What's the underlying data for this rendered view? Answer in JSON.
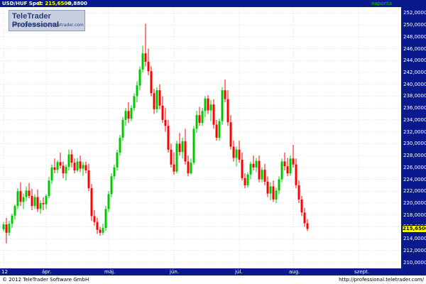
{
  "header": {
    "symbol": "USD/HUF Spot",
    "close": "C: 215,6500",
    "change": "-0,8800",
    "period": "naponta"
  },
  "logo": {
    "brand": "TeleTrader Professional",
    "url": "http://professional.teletrader.com"
  },
  "footer": {
    "copyright": "© 2012 TeleTrader Software GmbH",
    "url": "http://professional.teletrader.com/"
  },
  "colors": {
    "up": "#00c800",
    "down": "#ff0000",
    "axis_bg": "#0a1a8c",
    "grid": "#c0c0c0",
    "last_box": "#ffff00"
  },
  "chart_data": {
    "type": "candlestick",
    "last_value_label": "215,6500",
    "ylim": [
      209,
      253
    ],
    "y_tick_labels": [
      "210,0000",
      "212,0000",
      "214,0000",
      "216,0000",
      "218,0000",
      "220,0000",
      "222,0000",
      "224,0000",
      "226,0000",
      "228,0000",
      "230,0000",
      "232,0000",
      "234,0000",
      "236,0000",
      "238,0000",
      "240,0000",
      "242,0000",
      "244,0000",
      "246,0000",
      "248,0000",
      "250,0000",
      "252,0000"
    ],
    "x_tick_labels": [
      "12",
      "ápr.",
      "máj.",
      "jún.",
      "júl.",
      "aug.",
      "szept."
    ],
    "x_tick_index": [
      0,
      15,
      37,
      60,
      83,
      102,
      125
    ],
    "candles": [
      [
        215.6,
        216.8,
        215.2,
        216.4
      ],
      [
        216.4,
        217.5,
        213.2,
        215.0
      ],
      [
        215.0,
        217.0,
        214.5,
        216.5
      ],
      [
        216.5,
        218.2,
        215.8,
        217.9
      ],
      [
        217.9,
        219.8,
        217.2,
        219.5
      ],
      [
        219.5,
        222.5,
        219.0,
        222.0
      ],
      [
        222.0,
        223.5,
        219.5,
        220.2
      ],
      [
        220.2,
        221.6,
        219.0,
        221.0
      ],
      [
        221.0,
        222.8,
        220.3,
        222.1
      ],
      [
        222.1,
        223.4,
        220.8,
        221.2
      ],
      [
        221.2,
        222.4,
        218.8,
        219.5
      ],
      [
        219.5,
        221.5,
        219.0,
        221.0
      ],
      [
        221.0,
        222.3,
        218.5,
        219.0
      ],
      [
        219.0,
        220.5,
        218.2,
        220.0
      ],
      [
        220.0,
        221.0,
        218.8,
        219.8
      ],
      [
        219.8,
        221.5,
        219.0,
        221.2
      ],
      [
        221.2,
        224.4,
        220.8,
        223.8
      ],
      [
        223.8,
        226.5,
        223.2,
        226.0
      ],
      [
        226.0,
        227.5,
        225.0,
        225.6
      ],
      [
        225.6,
        227.2,
        225.0,
        226.9
      ],
      [
        226.9,
        228.5,
        225.8,
        226.3
      ],
      [
        226.3,
        227.0,
        224.2,
        225.0
      ],
      [
        225.0,
        226.5,
        223.8,
        226.1
      ],
      [
        226.1,
        229.0,
        225.5,
        228.2
      ],
      [
        228.2,
        229.0,
        226.0,
        226.8
      ],
      [
        226.8,
        227.5,
        225.0,
        225.5
      ],
      [
        225.5,
        227.6,
        225.2,
        227.0
      ],
      [
        227.0,
        228.0,
        225.2,
        225.8
      ],
      [
        225.8,
        226.9,
        224.6,
        226.4
      ],
      [
        226.4,
        227.0,
        225.0,
        225.5
      ],
      [
        225.5,
        226.6,
        222.0,
        222.5
      ],
      [
        222.5,
        223.2,
        217.0,
        217.8
      ],
      [
        217.8,
        218.8,
        216.2,
        216.8
      ],
      [
        216.8,
        217.5,
        214.8,
        215.5
      ],
      [
        215.5,
        216.0,
        214.5,
        215.0
      ],
      [
        215.0,
        216.5,
        214.6,
        215.8
      ],
      [
        215.8,
        219.5,
        215.3,
        219.0
      ],
      [
        219.0,
        222.0,
        218.5,
        221.5
      ],
      [
        221.5,
        225.0,
        221.0,
        224.5
      ],
      [
        224.5,
        226.5,
        224.0,
        226.0
      ],
      [
        226.0,
        229.0,
        225.5,
        228.5
      ],
      [
        228.5,
        231.5,
        228.0,
        231.0
      ],
      [
        231.0,
        234.5,
        230.5,
        234.0
      ],
      [
        234.0,
        236.0,
        233.0,
        235.5
      ],
      [
        235.5,
        237.0,
        233.5,
        234.2
      ],
      [
        234.2,
        236.5,
        233.8,
        236.0
      ],
      [
        236.0,
        238.5,
        235.5,
        238.0
      ],
      [
        238.0,
        240.5,
        237.0,
        239.8
      ],
      [
        239.8,
        243.0,
        239.0,
        242.5
      ],
      [
        242.5,
        246.5,
        242.0,
        245.2
      ],
      [
        245.2,
        250.2,
        243.0,
        243.8
      ],
      [
        243.8,
        246.0,
        241.5,
        242.2
      ],
      [
        242.2,
        243.0,
        238.0,
        238.5
      ],
      [
        238.5,
        239.2,
        235.0,
        235.8
      ],
      [
        235.8,
        239.5,
        235.2,
        239.0
      ],
      [
        239.0,
        240.0,
        235.8,
        236.4
      ],
      [
        236.4,
        238.0,
        233.5,
        234.0
      ],
      [
        234.0,
        236.0,
        232.0,
        233.0
      ],
      [
        233.0,
        234.0,
        228.5,
        229.0
      ],
      [
        229.0,
        230.0,
        226.0,
        226.5
      ],
      [
        226.5,
        228.5,
        224.8,
        225.3
      ],
      [
        225.3,
        230.5,
        225.0,
        230.0
      ],
      [
        230.0,
        231.8,
        228.0,
        228.6
      ],
      [
        228.6,
        231.0,
        227.5,
        230.4
      ],
      [
        230.4,
        232.5,
        226.5,
        227.0
      ],
      [
        227.0,
        228.0,
        224.5,
        225.0
      ],
      [
        225.0,
        227.5,
        224.8,
        226.8
      ],
      [
        226.8,
        233.0,
        226.5,
        232.5
      ],
      [
        232.5,
        235.5,
        231.8,
        234.8
      ],
      [
        234.8,
        236.2,
        233.0,
        233.5
      ],
      [
        233.5,
        236.0,
        233.0,
        235.5
      ],
      [
        235.5,
        238.0,
        234.5,
        237.6
      ],
      [
        237.6,
        238.2,
        235.0,
        235.6
      ],
      [
        235.6,
        237.3,
        233.8,
        236.6
      ],
      [
        236.6,
        237.5,
        232.5,
        233.2
      ],
      [
        233.2,
        234.0,
        230.5,
        231.0
      ],
      [
        231.0,
        234.2,
        230.5,
        233.8
      ],
      [
        233.8,
        239.5,
        233.2,
        239.0
      ],
      [
        239.0,
        240.8,
        237.0,
        237.5
      ],
      [
        237.5,
        239.0,
        233.0,
        233.6
      ],
      [
        233.6,
        234.8,
        229.0,
        229.5
      ],
      [
        229.5,
        230.5,
        227.0,
        227.6
      ],
      [
        227.6,
        229.5,
        226.2,
        229.0
      ],
      [
        229.0,
        230.5,
        226.8,
        227.3
      ],
      [
        227.3,
        228.5,
        223.8,
        224.2
      ],
      [
        224.2,
        225.0,
        222.5,
        223.0
      ],
      [
        223.0,
        225.2,
        222.6,
        224.8
      ],
      [
        224.8,
        227.0,
        224.0,
        226.6
      ],
      [
        226.6,
        228.0,
        225.5,
        226.0
      ],
      [
        226.0,
        227.6,
        225.2,
        227.1
      ],
      [
        227.1,
        228.0,
        223.5,
        224.0
      ],
      [
        224.0,
        226.0,
        223.5,
        225.6
      ],
      [
        225.6,
        226.6,
        223.0,
        223.6
      ],
      [
        223.6,
        224.5,
        221.0,
        221.6
      ],
      [
        221.6,
        223.5,
        220.5,
        222.8
      ],
      [
        222.8,
        223.8,
        220.2,
        220.6
      ],
      [
        220.6,
        222.6,
        220.0,
        222.1
      ],
      [
        222.1,
        224.5,
        221.5,
        224.0
      ],
      [
        224.0,
        227.5,
        223.5,
        227.0
      ],
      [
        227.0,
        228.5,
        225.5,
        226.2
      ],
      [
        226.2,
        227.6,
        224.5,
        225.0
      ],
      [
        225.0,
        228.0,
        224.6,
        227.5
      ],
      [
        227.5,
        229.8,
        226.0,
        226.5
      ],
      [
        226.5,
        227.5,
        222.5,
        223.0
      ],
      [
        223.0,
        223.8,
        220.0,
        220.6
      ],
      [
        220.6,
        221.2,
        217.8,
        218.4
      ],
      [
        218.4,
        219.2,
        216.0,
        216.6
      ],
      [
        216.6,
        217.3,
        215.3,
        215.65
      ]
    ]
  }
}
